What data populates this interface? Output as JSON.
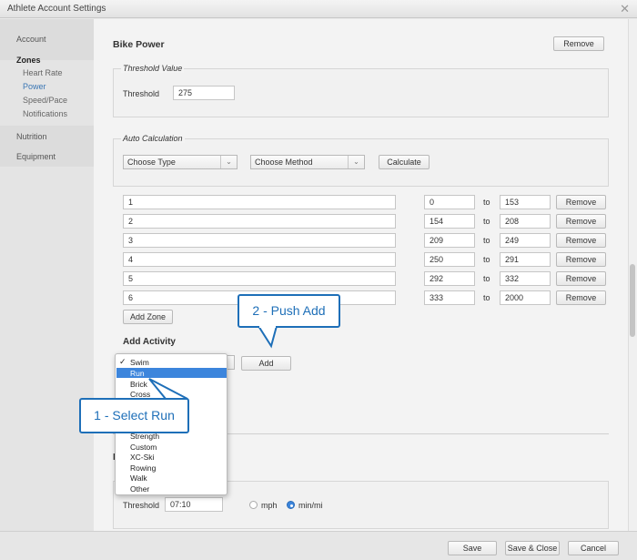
{
  "window": {
    "title": "Athlete Account Settings",
    "close": "✕"
  },
  "sidebar": {
    "account": "Account",
    "zones": "Zones",
    "zone_items": [
      "Heart Rate",
      "Power",
      "Speed/Pace",
      "Notifications"
    ],
    "nutrition": "Nutrition",
    "equipment": "Equipment"
  },
  "section": {
    "title": "Bike Power",
    "remove": "Remove"
  },
  "threshold_value": {
    "legend": "Threshold Value",
    "label": "Threshold",
    "value": "275"
  },
  "auto_calc": {
    "legend": "Auto Calculation",
    "type": "Choose Type",
    "method": "Choose Method",
    "calculate": "Calculate"
  },
  "zones": [
    {
      "name": "1",
      "from": "0",
      "to": "153"
    },
    {
      "name": "2",
      "from": "154",
      "to": "208"
    },
    {
      "name": "3",
      "from": "209",
      "to": "249"
    },
    {
      "name": "4",
      "from": "250",
      "to": "291"
    },
    {
      "name": "5",
      "from": "292",
      "to": "332"
    },
    {
      "name": "6",
      "from": "333",
      "to": "2000"
    }
  ],
  "zone_labels": {
    "to": "to",
    "remove": "Remove",
    "add_zone": "Add Zone"
  },
  "add_activity": {
    "title": "Add Activity",
    "add": "Add"
  },
  "dropdown": {
    "items": [
      "Swim",
      "Run",
      "Brick",
      "Cross",
      "Strength",
      "Custom",
      "XC-Ski",
      "Rowing",
      "Walk",
      "Other"
    ],
    "selected": "Swim",
    "highlighted": "Run"
  },
  "callouts": {
    "select_run": "1 - Select Run",
    "push_add": "2 - Push Add"
  },
  "lower_section": {
    "partial_heading": "D",
    "threshold_label": "Threshold",
    "threshold_value": "07:10",
    "unit_mph": "mph",
    "unit_minmi": "min/mi",
    "selected_unit": "min/mi"
  },
  "footer": {
    "save": "Save",
    "save_close": "Save & Close",
    "cancel": "Cancel"
  },
  "colors": {
    "accent": "#1e6fb8",
    "highlight": "#3c85dc"
  }
}
